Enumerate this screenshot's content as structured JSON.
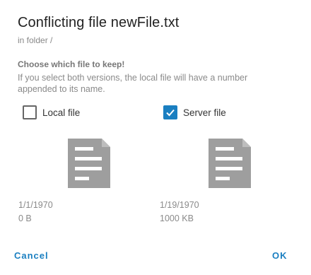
{
  "dialog": {
    "title": "Conflicting file newFile.txt",
    "subtitle": "in folder /",
    "prompt": "Choose which file to keep!",
    "explanation": "If you select both versions, the local file will have a number appended to its name."
  },
  "local": {
    "label": "Local file",
    "checked": false,
    "date": "1/1/1970",
    "size": "0 B",
    "icon": "document-icon"
  },
  "server": {
    "label": "Server file",
    "checked": true,
    "date": "1/19/1970",
    "size": "1000 KB",
    "icon": "document-icon"
  },
  "buttons": {
    "cancel": "Cancel",
    "ok": "OK"
  },
  "colors": {
    "accent": "#1a7fc1",
    "icon": "#9e9e9e"
  }
}
